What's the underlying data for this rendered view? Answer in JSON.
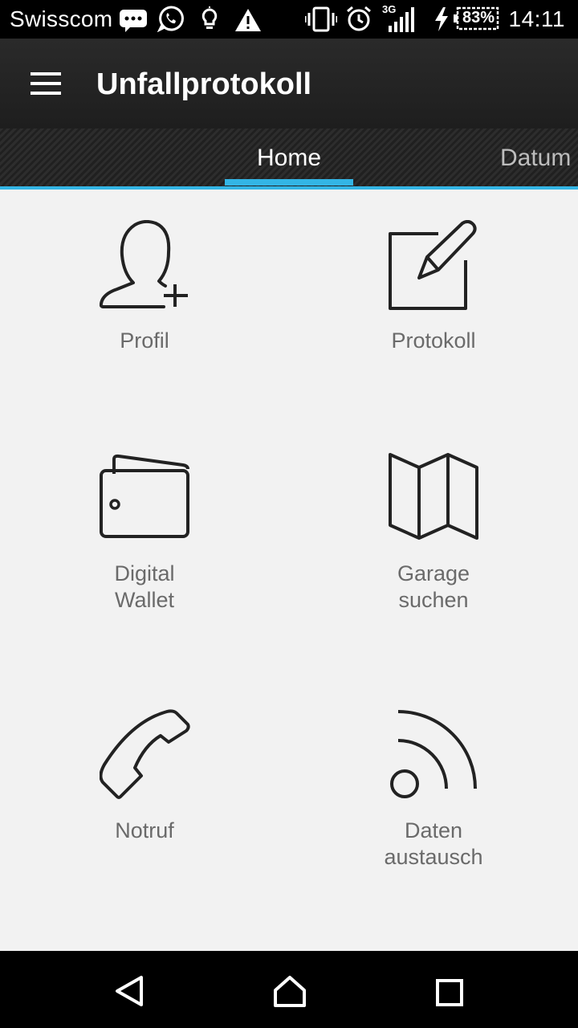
{
  "status_bar": {
    "carrier": "Swisscom",
    "network": "3G",
    "battery": "83%",
    "time": "14:11",
    "icons": [
      "message-icon",
      "whatsapp-icon",
      "lightbulb-icon",
      "warning-icon",
      "vibrate-icon",
      "alarm-icon",
      "signal-icon",
      "charging-icon",
      "battery-icon"
    ]
  },
  "app_bar": {
    "title": "Unfallprotokoll",
    "menu_icon": "hamburger-menu-icon"
  },
  "tabs": [
    {
      "label": "Home",
      "selected": true
    },
    {
      "label": "Datum",
      "selected": false
    }
  ],
  "accent_color": "#33b5e5",
  "tiles": [
    {
      "icon": "add-user-icon",
      "line1": "Profil",
      "line2": ""
    },
    {
      "icon": "edit-icon",
      "line1": "Protokoll",
      "line2": ""
    },
    {
      "icon": "wallet-icon",
      "line1": "Digital",
      "line2": "Wallet"
    },
    {
      "icon": "map-icon",
      "line1": "Garage",
      "line2": "suchen"
    },
    {
      "icon": "phone-icon",
      "line1": "Notruf",
      "line2": ""
    },
    {
      "icon": "feed-icon",
      "line1": "Daten",
      "line2": "austausch"
    }
  ],
  "nav_bar": {
    "back_icon": "back-triangle-icon",
    "home_icon": "home-icon",
    "recents_icon": "recents-square-icon"
  }
}
